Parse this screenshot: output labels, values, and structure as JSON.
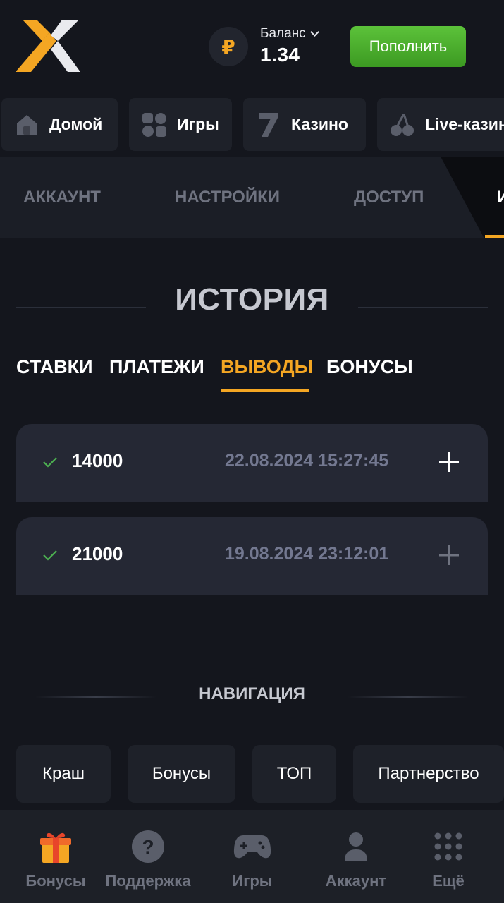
{
  "header": {
    "logo": "x-logo",
    "currency_symbol": "₽",
    "balance_label": "Баланс",
    "balance_value": "1.34",
    "deposit_label": "Пополнить"
  },
  "categories": [
    {
      "label": "Домой",
      "icon": "home-icon"
    },
    {
      "label": "Игры",
      "icon": "grid-icon"
    },
    {
      "label": "Казино",
      "icon": "seven-icon"
    },
    {
      "label": "Live-казино",
      "icon": "cherries-icon"
    }
  ],
  "profile_tabs": [
    "АККАУНТ",
    "НАСТРОЙКИ",
    "ДОСТУП",
    "ИСТОРИЯ"
  ],
  "history": {
    "title": "ИСТОРИЯ",
    "tabs": [
      "СТАВКИ",
      "ПЛАТЕЖИ",
      "ВЫВОДЫ",
      "БОНУСЫ"
    ],
    "active_tab": "ВЫВОДЫ",
    "items": [
      {
        "amount": "14000",
        "date": "22.08.2024 15:27:45",
        "status": "success"
      },
      {
        "amount": "21000",
        "date": "19.08.2024 23:12:01",
        "status": "success"
      }
    ]
  },
  "navigation": {
    "title": "НАВИГАЦИЯ",
    "links": [
      "Краш",
      "Бонусы",
      "ТОП",
      "Партнерство"
    ]
  },
  "bottom_bar": [
    {
      "label": "Бонусы",
      "icon": "gift-icon"
    },
    {
      "label": "Поддержка",
      "icon": "help-icon"
    },
    {
      "label": "Игры",
      "icon": "gamepad-icon"
    },
    {
      "label": "Аккаунт",
      "icon": "user-icon"
    },
    {
      "label": "Ещё",
      "icon": "dots-grid-icon"
    }
  ],
  "colors": {
    "accent": "#f4a623",
    "deposit_green": "#4caf30",
    "check_green": "#4caf50",
    "background": "#14161d"
  }
}
